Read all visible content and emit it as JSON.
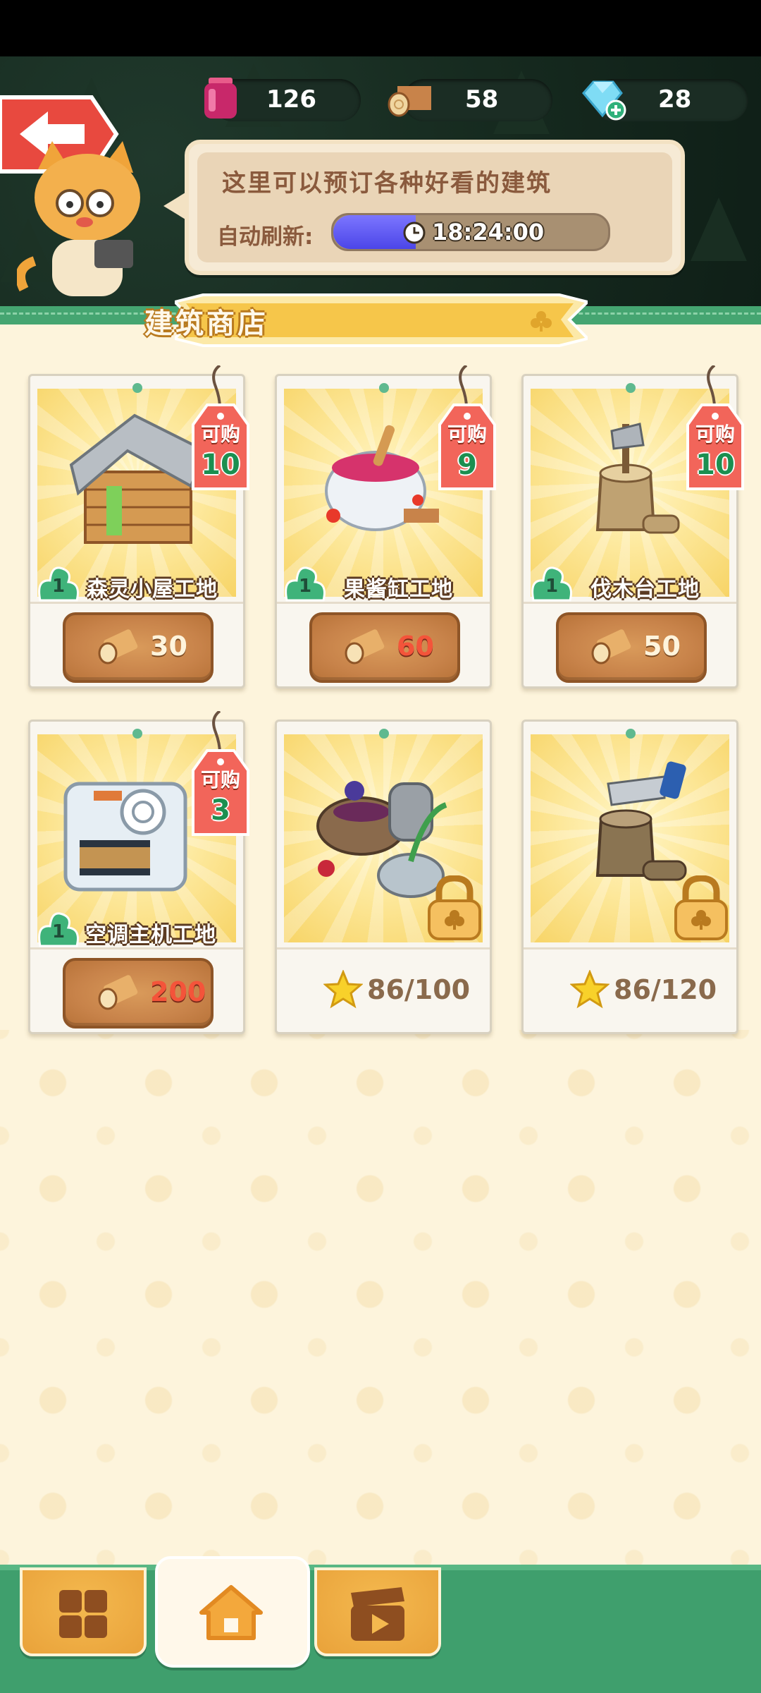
{
  "resources": [
    {
      "name": "jam-jar-icon",
      "value": "126"
    },
    {
      "name": "wood-log-icon",
      "value": "58"
    },
    {
      "name": "diamond-plus-icon",
      "value": "28"
    }
  ],
  "speech": {
    "title": "这里可以预订各种好看的建筑",
    "refresh_label": "自动刷新:",
    "timer": "18:24:00",
    "timer_progress": 0.3
  },
  "banner": {
    "title": "建筑商店"
  },
  "tag_label": "可购",
  "cards": [
    {
      "name": "森灵小屋工地",
      "level": "1",
      "available": "10",
      "price": "30",
      "price_affordable": true
    },
    {
      "name": "果酱缸工地",
      "level": "1",
      "available": "9",
      "price": "60",
      "price_affordable": false
    },
    {
      "name": "伐木台工地",
      "level": "1",
      "available": "10",
      "price": "50",
      "price_affordable": true
    },
    {
      "name": "空调主机工地",
      "level": "1",
      "available": "3",
      "price": "200",
      "price_affordable": false
    },
    {
      "locked": true,
      "star_requirement": "86/100"
    },
    {
      "locked": true,
      "star_requirement": "86/120"
    }
  ],
  "nav": [
    {
      "icon": "grid-icon",
      "active": false
    },
    {
      "icon": "house-icon",
      "active": true
    },
    {
      "icon": "video-clapper-icon",
      "active": false
    }
  ],
  "colors": {
    "accent_green": "#45a571",
    "price_wood": "#c8834a",
    "insufficient_red": "#f4543a",
    "timer_blue": "#5a54f0"
  }
}
